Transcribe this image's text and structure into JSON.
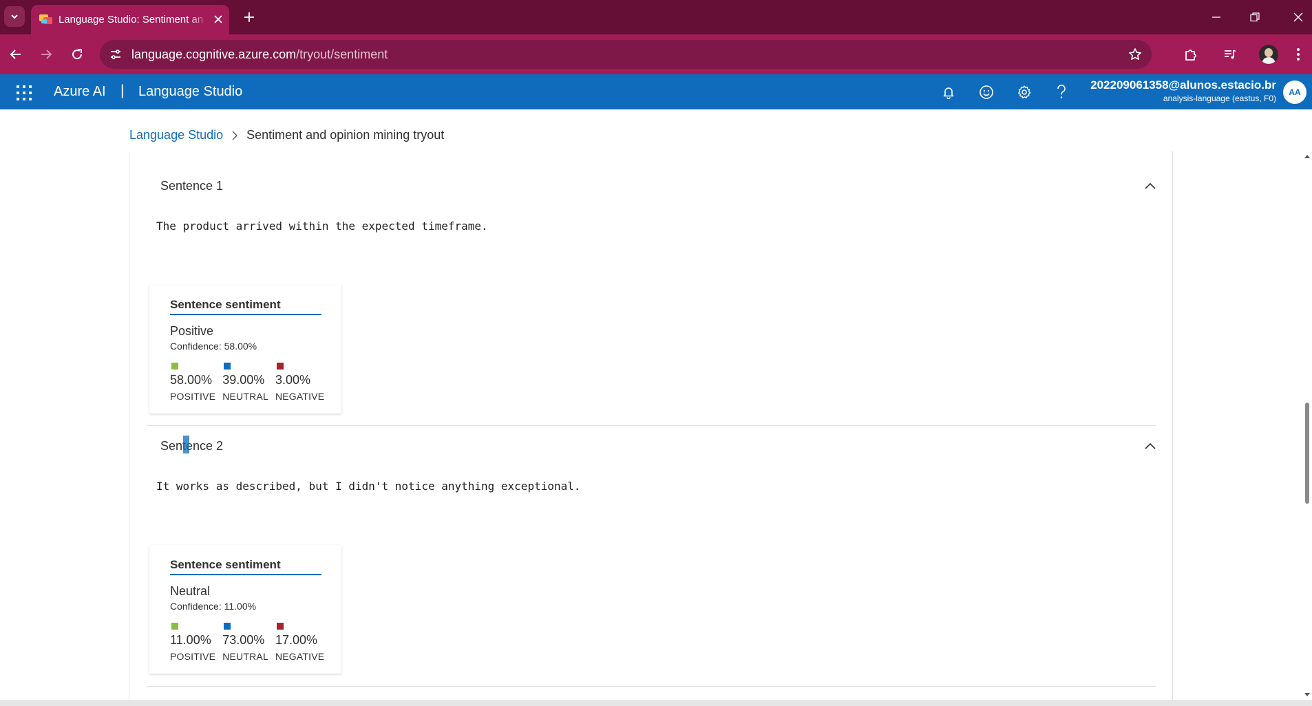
{
  "browser": {
    "tab_title": "Language Studio: Sentiment and opinion mining tryout",
    "url_host": "language.cognitive.azure.com",
    "url_path": "/tryout/sentiment"
  },
  "app": {
    "brand": "Azure AI",
    "divider": "|",
    "product": "Language Studio",
    "account_email": "202209061358@alunos.estacio.br",
    "account_resource": "analysis-language (eastus, F0)",
    "avatar_initials": "AA"
  },
  "breadcrumb": {
    "root": "Language Studio",
    "current": "Sentiment and opinion mining tryout"
  },
  "sentences": [
    {
      "title": "Sentence 1",
      "text": "The product arrived within the expected timeframe.",
      "card_title": "Sentence sentiment",
      "label": "Positive",
      "confidence": "Confidence: 58.00%",
      "scores": [
        {
          "value": "58.00%",
          "name": "POSITIVE",
          "color": "#8cbd3c"
        },
        {
          "value": "39.00%",
          "name": "NEUTRAL",
          "color": "#0f6cbd"
        },
        {
          "value": "3.00%",
          "name": "NEGATIVE",
          "color": "#a4262c"
        }
      ]
    },
    {
      "title": "Sentence 2",
      "text": "It works as described, but I didn't notice anything exceptional.",
      "card_title": "Sentence sentiment",
      "label": "Neutral",
      "confidence": "Confidence: 11.00%",
      "scores": [
        {
          "value": "11.00%",
          "name": "POSITIVE",
          "color": "#8cbd3c"
        },
        {
          "value": "73.00%",
          "name": "NEUTRAL",
          "color": "#0f6cbd"
        },
        {
          "value": "17.00%",
          "name": "NEGATIVE",
          "color": "#a4262c"
        }
      ]
    }
  ],
  "colors": {
    "browser_frame": "#650e36",
    "browser_toolbar": "#a31b57",
    "app_header": "#0f6cbd",
    "positive": "#8cbd3c",
    "neutral": "#0f6cbd",
    "negative": "#a4262c"
  },
  "icons": {
    "tab_list": "chevron-down-icon",
    "tab_close": "close-icon",
    "new_tab": "plus-icon",
    "back": "arrow-left-icon",
    "forward": "arrow-right-icon",
    "reload": "reload-icon",
    "site_info": "tune-icon",
    "bookmark": "star-icon",
    "extensions": "puzzle-icon",
    "media": "media-queue-icon",
    "menu": "kebab-icon",
    "app_launcher": "waffle-icon",
    "notifications": "bell-icon",
    "feedback": "smiley-icon",
    "settings": "gear-icon",
    "help": "question-icon",
    "collapse": "chevron-up-icon"
  }
}
